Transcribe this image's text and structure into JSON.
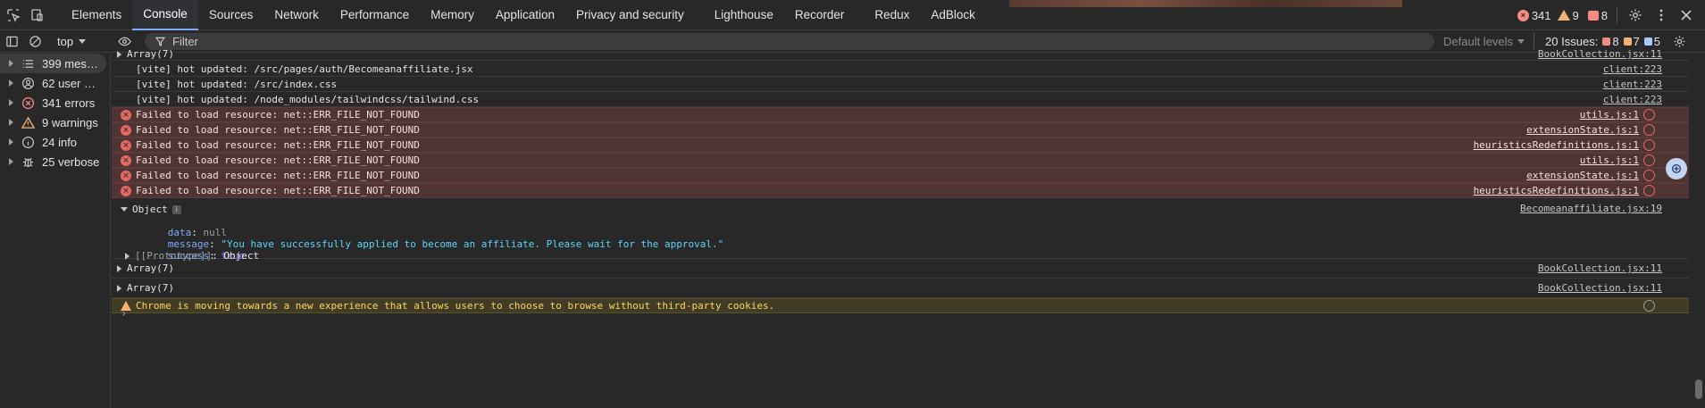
{
  "tabbar": {
    "tabs": [
      "Elements",
      "Console",
      "Sources",
      "Network",
      "Performance",
      "Memory",
      "Application",
      "Privacy and security",
      "Lighthouse",
      "Recorder",
      "Redux",
      "AdBlock"
    ],
    "active_tab": "Console",
    "error_count": "341",
    "warning_count": "9",
    "issue_flag_count": "8"
  },
  "toolbar": {
    "context": "top",
    "filter_placeholder": "Filter",
    "levels": "Default levels",
    "issues_label": "20 Issues:",
    "issue_error": "8",
    "issue_warning": "7",
    "issue_info": "5"
  },
  "sidebar": {
    "items": [
      {
        "label": "399 mes…",
        "icon": "list-icon"
      },
      {
        "label": "62 user …",
        "icon": "user-icon"
      },
      {
        "label": "341 errors",
        "icon": "error-icon"
      },
      {
        "label": "9 warnings",
        "icon": "warning-icon"
      },
      {
        "label": "24 info",
        "icon": "info-icon"
      },
      {
        "label": "25 verbose",
        "icon": "bug-icon"
      }
    ]
  },
  "log": {
    "partial_top": {
      "msg": "Array(7)",
      "src": "BookCollection.jsx:11"
    },
    "vite": [
      {
        "msg": "[vite] hot updated: /src/pages/auth/Becomeanaffiliate.jsx",
        "src": "client:223"
      },
      {
        "msg": "[vite] hot updated: /src/index.css",
        "src": "client:223"
      },
      {
        "msg": "[vite] hot updated: /node_modules/tailwindcss/tailwind.css",
        "src": "client:223"
      }
    ],
    "errors": [
      {
        "msg": "Failed to load resource: net::ERR_FILE_NOT_FOUND",
        "src": "utils.js:1"
      },
      {
        "msg": "Failed to load resource: net::ERR_FILE_NOT_FOUND",
        "src": "extensionState.js:1"
      },
      {
        "msg": "Failed to load resource: net::ERR_FILE_NOT_FOUND",
        "src": "heuristicsRedefinitions.js:1"
      },
      {
        "msg": "Failed to load resource: net::ERR_FILE_NOT_FOUND",
        "src": "utils.js:1"
      },
      {
        "msg": "Failed to load resource: net::ERR_FILE_NOT_FOUND",
        "src": "extensionState.js:1"
      },
      {
        "msg": "Failed to load resource: net::ERR_FILE_NOT_FOUND",
        "src": "heuristicsRedefinitions.js:1"
      }
    ],
    "object": {
      "label": "Object",
      "src": "Becomeanaffiliate.jsx:19",
      "data_key": "data",
      "data_val": "null",
      "message_key": "message",
      "message_val": "\"You have successfully applied to become an affiliate. Please wait for the approval.\"",
      "success_key": "success",
      "success_val": "true",
      "proto_key": "[[Prototype]]",
      "proto_val": "Object"
    },
    "arrays": [
      {
        "msg": "Array(7)",
        "src": "BookCollection.jsx:11"
      },
      {
        "msg": "Array(7)",
        "src": "BookCollection.jsx:11"
      }
    ],
    "warning": {
      "msg": "Chrome is moving towards a new experience that allows users to choose to browse without third-party cookies."
    },
    "prompt": "›"
  }
}
